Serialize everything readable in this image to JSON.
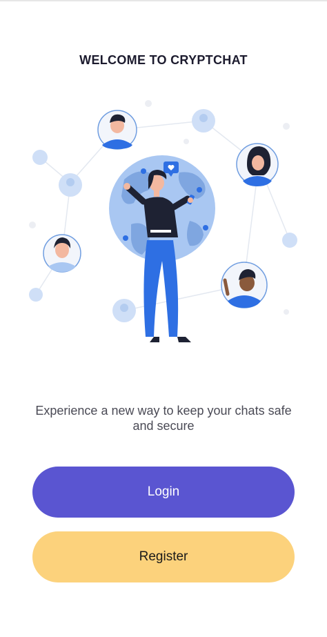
{
  "welcome": {
    "title": "WELCOME TO CRYPTCHAT"
  },
  "hero": {
    "illustration": "global-chat-network-illustration"
  },
  "tagline": "Experience a new way to keep your chats safe and secure",
  "actions": {
    "login_label": "Login",
    "register_label": "Register"
  },
  "colors": {
    "primary": "#5A55D1",
    "secondary": "#FCD27C",
    "accent_blue": "#2E6FE3",
    "globe": "#A9C7F2",
    "title_text": "#1C1B2E"
  }
}
